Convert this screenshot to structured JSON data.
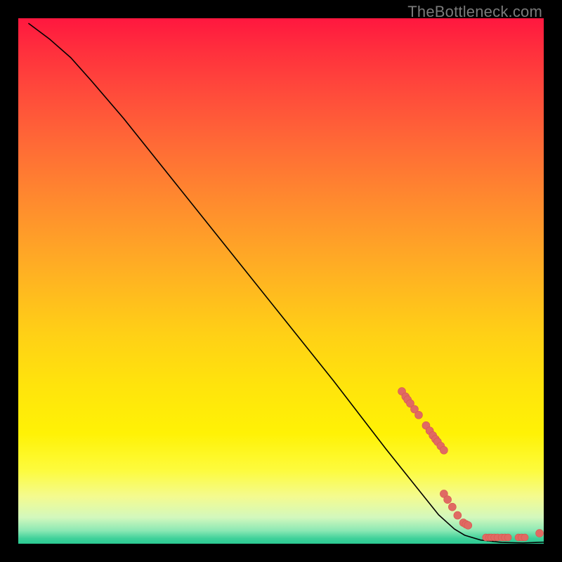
{
  "watermark": "TheBottleneck.com",
  "colors": {
    "curve_stroke": "#000000",
    "marker_fill": "#e06a63",
    "marker_stroke": "#d9574f"
  },
  "chart_data": {
    "type": "line",
    "title": "",
    "xlabel": "",
    "ylabel": "",
    "xlim": [
      0,
      100
    ],
    "ylim": [
      0,
      100
    ],
    "series": [
      {
        "name": "curve",
        "x": [
          2,
          6,
          10,
          14,
          20,
          30,
          40,
          50,
          60,
          70,
          76,
          80,
          83,
          85,
          88,
          92,
          96,
          100
        ],
        "y": [
          99,
          96,
          92.5,
          88,
          81,
          68.5,
          56,
          43.5,
          31,
          18,
          10.5,
          5.5,
          2.8,
          1.6,
          0.7,
          0.25,
          0.15,
          0.3
        ]
      }
    ],
    "markers": {
      "group_a": [
        {
          "x": 73,
          "y": 29
        },
        {
          "x": 73.7,
          "y": 28
        },
        {
          "x": 74.1,
          "y": 27.4
        },
        {
          "x": 74.6,
          "y": 26.7
        },
        {
          "x": 75.4,
          "y": 25.6
        },
        {
          "x": 76.2,
          "y": 24.5
        },
        {
          "x": 77.6,
          "y": 22.5
        },
        {
          "x": 78.3,
          "y": 21.5
        },
        {
          "x": 78.9,
          "y": 20.6
        },
        {
          "x": 79.4,
          "y": 19.9
        },
        {
          "x": 79.8,
          "y": 19.4
        },
        {
          "x": 80.4,
          "y": 18.6
        },
        {
          "x": 81.0,
          "y": 17.8
        }
      ],
      "group_b": [
        {
          "x": 81.0,
          "y": 9.5
        },
        {
          "x": 81.7,
          "y": 8.4
        },
        {
          "x": 82.6,
          "y": 7.0
        },
        {
          "x": 83.6,
          "y": 5.4
        },
        {
          "x": 84.7,
          "y": 4.0
        },
        {
          "x": 85.2,
          "y": 3.7
        },
        {
          "x": 85.6,
          "y": 3.5
        }
      ],
      "group_c": [
        {
          "x": 89.0,
          "y": 1.2
        },
        {
          "x": 89.6,
          "y": 1.2
        },
        {
          "x": 90.0,
          "y": 1.2
        },
        {
          "x": 90.6,
          "y": 1.2
        },
        {
          "x": 91.2,
          "y": 1.2
        },
        {
          "x": 92.0,
          "y": 1.2
        },
        {
          "x": 92.6,
          "y": 1.2
        },
        {
          "x": 93.2,
          "y": 1.2
        },
        {
          "x": 95.2,
          "y": 1.2
        },
        {
          "x": 95.8,
          "y": 1.2
        },
        {
          "x": 96.4,
          "y": 1.2
        }
      ],
      "end_point": {
        "x": 99.2,
        "y": 2.0
      }
    }
  }
}
